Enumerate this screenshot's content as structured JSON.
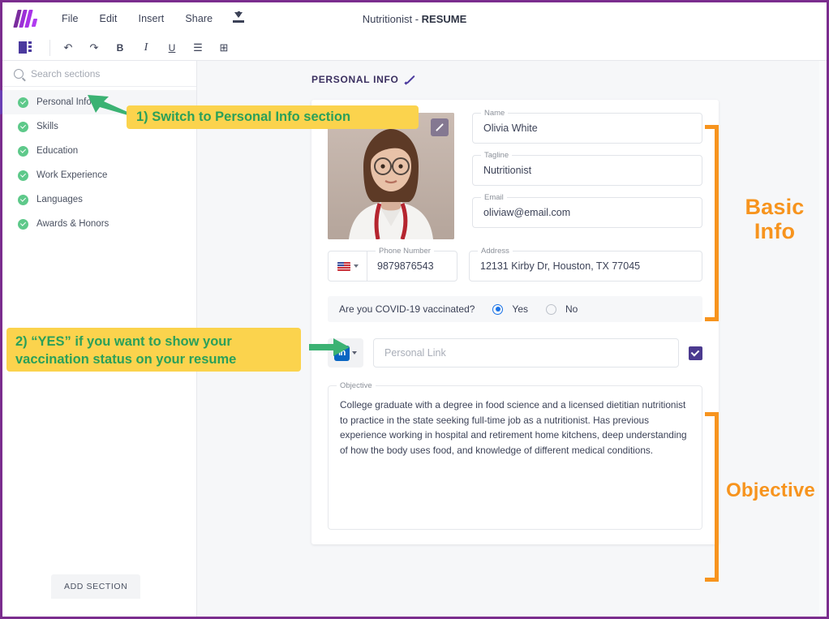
{
  "app": {
    "document_title_prefix": "Nutritionist - ",
    "document_title_suffix": "RESUME",
    "logo_name": "kickresume-logo"
  },
  "menubar": {
    "items": [
      {
        "label": "File"
      },
      {
        "label": "Edit"
      },
      {
        "label": "Insert"
      },
      {
        "label": "Share"
      }
    ],
    "download_icon": "download-icon"
  },
  "toolbar": {
    "panel_toggle_icon": "panel-toggle-icon",
    "buttons": [
      {
        "name": "undo-button",
        "glyph": "↶"
      },
      {
        "name": "redo-button",
        "glyph": "↷"
      },
      {
        "name": "bold-button",
        "glyph": "B"
      },
      {
        "name": "italic-button",
        "glyph": "I"
      },
      {
        "name": "underline-button",
        "glyph": "U"
      },
      {
        "name": "bullet-list-button",
        "glyph": "☰"
      },
      {
        "name": "insert-block-button",
        "glyph": "⊞"
      }
    ]
  },
  "sidebar": {
    "search_placeholder": "Search sections",
    "sections": [
      {
        "label": "Personal Info",
        "active": true
      },
      {
        "label": "Skills",
        "active": false
      },
      {
        "label": "Education",
        "active": false
      },
      {
        "label": "Work Experience",
        "active": false
      },
      {
        "label": "Languages",
        "active": false
      },
      {
        "label": "Awards & Honors",
        "active": false
      }
    ],
    "add_section_label": "ADD SECTION"
  },
  "canvas": {
    "heading": "PERSONAL INFO",
    "edit_icon": "pencil-icon",
    "photo": {
      "name": "profile-photo",
      "edit_icon": "pencil-icon"
    },
    "fields": {
      "name": {
        "label": "Name",
        "value": "Olivia White"
      },
      "tagline": {
        "label": "Tagline",
        "value": "Nutritionist"
      },
      "email": {
        "label": "Email",
        "value": "oliviaw@email.com"
      },
      "phone": {
        "label": "Phone Number",
        "value": "9879876543",
        "country_icon": "us-flag-icon"
      },
      "address": {
        "label": "Address",
        "value": "12131 Kirby Dr, Houston, TX 77045"
      }
    },
    "vaccination": {
      "question": "Are you COVID-19 vaccinated?",
      "yes_label": "Yes",
      "no_label": "No",
      "selected": "Yes"
    },
    "personal_link": {
      "network_icon": "linkedin-icon",
      "placeholder": "Personal Link",
      "checkbox_checked": true
    },
    "objective": {
      "label": "Objective",
      "text": "College graduate with a degree in food science and a licensed dietitian nutritionist to practice in the state seeking full-time job as a nutritionist. Has previous experience working in hospital and retirement home kitchens, deep understanding of how the body uses food, and knowledge of different medical conditions."
    }
  },
  "annotations": {
    "callout_1": "1)  Switch to Personal Info section",
    "callout_2_line1": "2)  “YES” if you want to show your",
    "callout_2_line2": "vaccination status on your resume",
    "bracket_label_basic_line1": "Basic",
    "bracket_label_basic_line2": "Info",
    "bracket_label_objective": "Objective",
    "colors": {
      "callout_background": "#fbd34d",
      "callout_text": "#2aa05a",
      "arrow": "#3bb273",
      "bracket": "#f7941e",
      "page_border": "#7b2d8e"
    }
  }
}
